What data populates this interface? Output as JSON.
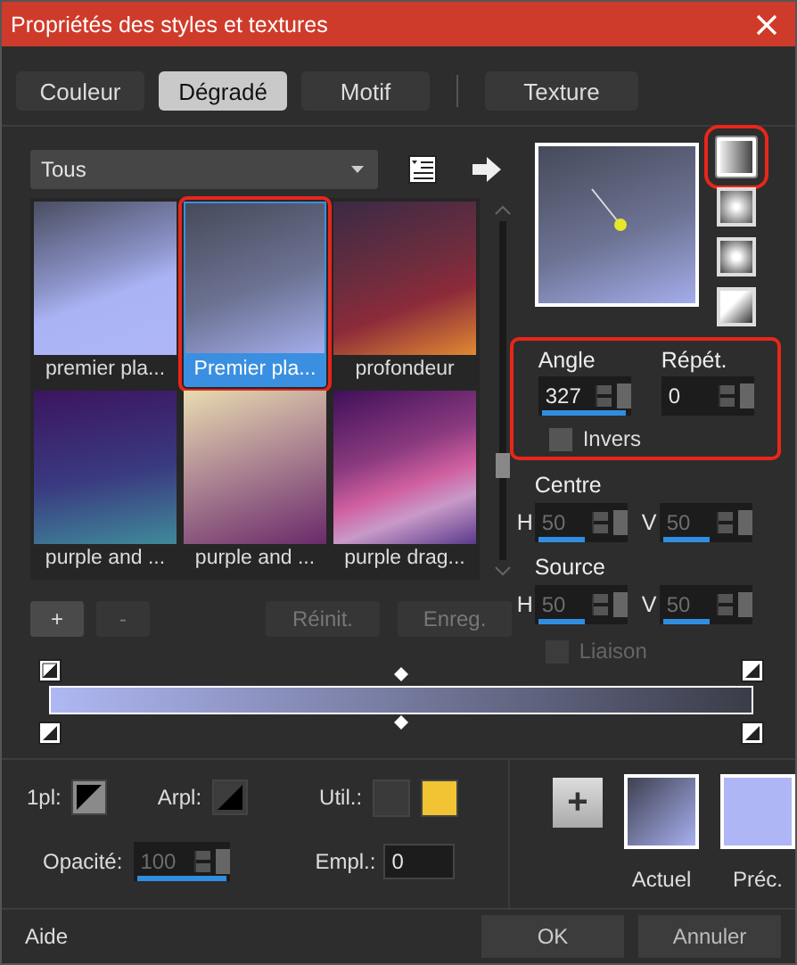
{
  "window": {
    "title": "Propriétés des styles et textures"
  },
  "tabs": [
    {
      "label": "Couleur",
      "selected": false
    },
    {
      "label": "Dégradé",
      "selected": true
    },
    {
      "label": "Motif",
      "selected": false
    },
    {
      "label": "Texture",
      "selected": false
    }
  ],
  "library": {
    "category": "Tous",
    "items": [
      {
        "label": "premier pla...",
        "selected": false,
        "highlighted": false
      },
      {
        "label": "Premier pla...",
        "selected": true,
        "highlighted": true
      },
      {
        "label": "profondeur",
        "selected": false,
        "highlighted": false
      },
      {
        "label": "purple and ...",
        "selected": false,
        "highlighted": false
      },
      {
        "label": "purple and ...",
        "selected": false,
        "highlighted": false
      },
      {
        "label": "purple drag...",
        "selected": false,
        "highlighted": false
      }
    ],
    "buttons": [
      {
        "label": "+",
        "disabled": false
      },
      {
        "label": "-",
        "disabled": true
      },
      {
        "label": "Réinit.",
        "disabled": true
      },
      {
        "label": "Enreg.",
        "disabled": true
      }
    ]
  },
  "gradient_styles": [
    {
      "kind": "linear",
      "selected": true,
      "highlighted": true
    },
    {
      "kind": "rectangular",
      "selected": false,
      "highlighted": false
    },
    {
      "kind": "radial",
      "selected": false,
      "highlighted": false
    },
    {
      "kind": "corner",
      "selected": false,
      "highlighted": false
    }
  ],
  "geometry": {
    "highlighted": true,
    "angle": {
      "label": "Angle",
      "value": "327",
      "level": 0.91
    },
    "repeat": {
      "label": "Répét.",
      "value": "0",
      "level": 0
    },
    "invert": {
      "label": "Invers",
      "checked": false
    }
  },
  "centre": {
    "label": "Centre",
    "fields": [
      {
        "label": "H",
        "value": "50",
        "level": 0.5,
        "disabled": true
      },
      {
        "label": "V",
        "value": "50",
        "level": 0.5,
        "disabled": true
      }
    ]
  },
  "source": {
    "label": "Source",
    "fields": [
      {
        "label": "H",
        "value": "50",
        "level": 0.5,
        "disabled": true
      },
      {
        "label": "V",
        "value": "50",
        "level": 0.5,
        "disabled": true
      }
    ],
    "link": {
      "label": "Liaison",
      "checked": false,
      "disabled": true
    }
  },
  "stop_settings": {
    "foreground": {
      "label": "1pl:",
      "selected": true
    },
    "background": {
      "label": "Arpl:",
      "selected": false
    },
    "user": {
      "label": "Util.:",
      "colors": [
        {
          "color": "#3a3a3a"
        },
        {
          "color": "#f2c433"
        }
      ]
    },
    "opacity": {
      "label": "Opacité:",
      "value": "100",
      "level": 1,
      "disabled": true
    },
    "location": {
      "label": "Empl.:",
      "value": "0"
    }
  },
  "swatches": {
    "add": "+",
    "current": {
      "label": "Actuel"
    },
    "previous": {
      "label": "Préc."
    }
  },
  "footer": {
    "help": "Aide",
    "ok": "OK",
    "cancel": "Annuler"
  }
}
